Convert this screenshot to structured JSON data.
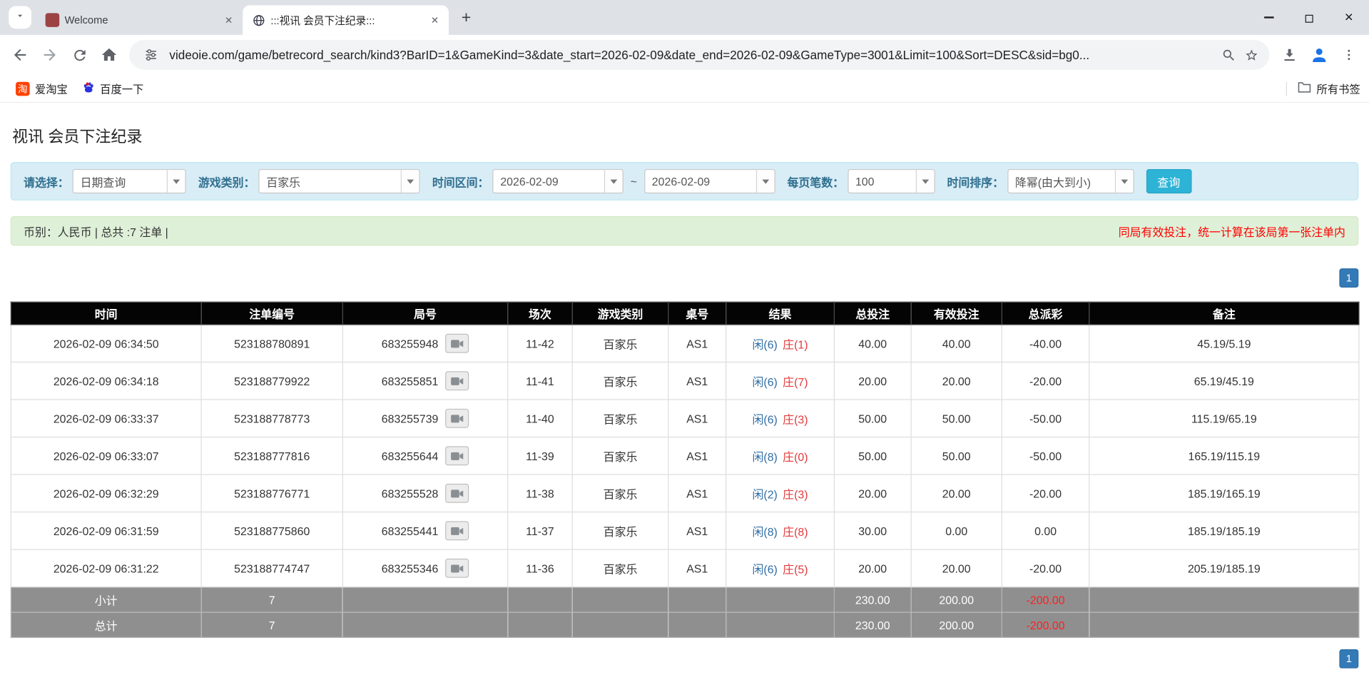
{
  "colors": {
    "link_blue": "#337ab7",
    "player_blue": "#2e6da4",
    "banker_red": "#e4393c",
    "negative_red": "#e60000",
    "warn_red": "#ff0000",
    "label_blue": "#31708f",
    "filter_bar_bg": "#d9edf7",
    "filter_bar_border": "#bce8f1",
    "info_bar_bg": "#dff0d8",
    "info_bar_border": "#d6e9c6",
    "search_button_bg": "#2db3d6",
    "table_header_bg": "#040404",
    "sum_row_bg": "#8f8f8f"
  },
  "browser": {
    "tabs": [
      {
        "title": "Welcome"
      },
      {
        "title": ":::视讯 会员下注纪录:::"
      }
    ],
    "new_tab_glyph": "+",
    "close_glyph": "✕",
    "url": "videoie.com/game/betrecord_search/kind3?BarID=1&GameKind=3&date_start=2026-02-09&date_end=2026-02-09&GameType=3001&Limit=100&Sort=DESC&sid=bg0...",
    "bookmarks": [
      {
        "label": "爱淘宝",
        "icon_glyph": "淘"
      },
      {
        "label": "百度一下"
      }
    ],
    "all_bookmarks_label": "所有书签"
  },
  "page": {
    "title": "视讯 会员下注纪录",
    "filters": {
      "choose_label": "请选择：",
      "choose_value": "日期查询",
      "game_kind_label": "游戏类别：",
      "game_kind_value": "百家乐",
      "date_range_label": "时间区间：",
      "date_start": "2026-02-09",
      "range_separator": "~",
      "date_end": "2026-02-09",
      "per_page_label": "每页笔数：",
      "per_page_value": "100",
      "sort_label": "时间排序：",
      "sort_value": "降幂(由大到小)",
      "search_button": "查询"
    },
    "info_bar": {
      "summary": "币别：人民币 | 总共 :7 注单 |",
      "notice": "同局有效投注，统一计算在该局第一张注单内"
    },
    "pagination": "1",
    "table": {
      "headers": [
        "时间",
        "注单编号",
        "局号",
        "场次",
        "游戏类别",
        "桌号",
        "结果",
        "总投注",
        "有效投注",
        "总派彩",
        "备注"
      ],
      "rows": [
        {
          "time": "2026-02-09 06:34:50",
          "bet_id": "523188780891",
          "round": "683255948",
          "session": "11-42",
          "game": "百家乐",
          "table_no": "AS1",
          "result_player": "闲(6)",
          "result_banker": "庄(1)",
          "total_bet": "40.00",
          "valid_bet": "40.00",
          "payout": "-40.00",
          "note": "45.19/5.19"
        },
        {
          "time": "2026-02-09 06:34:18",
          "bet_id": "523188779922",
          "round": "683255851",
          "session": "11-41",
          "game": "百家乐",
          "table_no": "AS1",
          "result_player": "闲(6)",
          "result_banker": "庄(7)",
          "total_bet": "20.00",
          "valid_bet": "20.00",
          "payout": "-20.00",
          "note": "65.19/45.19"
        },
        {
          "time": "2026-02-09 06:33:37",
          "bet_id": "523188778773",
          "round": "683255739",
          "session": "11-40",
          "game": "百家乐",
          "table_no": "AS1",
          "result_player": "闲(6)",
          "result_banker": "庄(3)",
          "total_bet": "50.00",
          "valid_bet": "50.00",
          "payout": "-50.00",
          "note": "115.19/65.19"
        },
        {
          "time": "2026-02-09 06:33:07",
          "bet_id": "523188777816",
          "round": "683255644",
          "session": "11-39",
          "game": "百家乐",
          "table_no": "AS1",
          "result_player": "闲(8)",
          "result_banker": "庄(0)",
          "total_bet": "50.00",
          "valid_bet": "50.00",
          "payout": "-50.00",
          "note": "165.19/115.19"
        },
        {
          "time": "2026-02-09 06:32:29",
          "bet_id": "523188776771",
          "round": "683255528",
          "session": "11-38",
          "game": "百家乐",
          "table_no": "AS1",
          "result_player": "闲(2)",
          "result_banker": "庄(3)",
          "total_bet": "20.00",
          "valid_bet": "20.00",
          "payout": "-20.00",
          "note": "185.19/165.19"
        },
        {
          "time": "2026-02-09 06:31:59",
          "bet_id": "523188775860",
          "round": "683255441",
          "session": "11-37",
          "game": "百家乐",
          "table_no": "AS1",
          "result_player": "闲(8)",
          "result_banker": "庄(8)",
          "total_bet": "30.00",
          "valid_bet": "0.00",
          "payout": "0.00",
          "note": "185.19/185.19"
        },
        {
          "time": "2026-02-09 06:31:22",
          "bet_id": "523188774747",
          "round": "683255346",
          "session": "11-36",
          "game": "百家乐",
          "table_no": "AS1",
          "result_player": "闲(6)",
          "result_banker": "庄(5)",
          "total_bet": "20.00",
          "valid_bet": "20.00",
          "payout": "-20.00",
          "note": "205.19/185.19"
        }
      ],
      "subtotal": {
        "label": "小计",
        "count": "7",
        "total_bet": "230.00",
        "valid_bet": "200.00",
        "payout": "-200.00"
      },
      "total": {
        "label": "总计",
        "count": "7",
        "total_bet": "230.00",
        "valid_bet": "200.00",
        "payout": "-200.00"
      }
    }
  }
}
